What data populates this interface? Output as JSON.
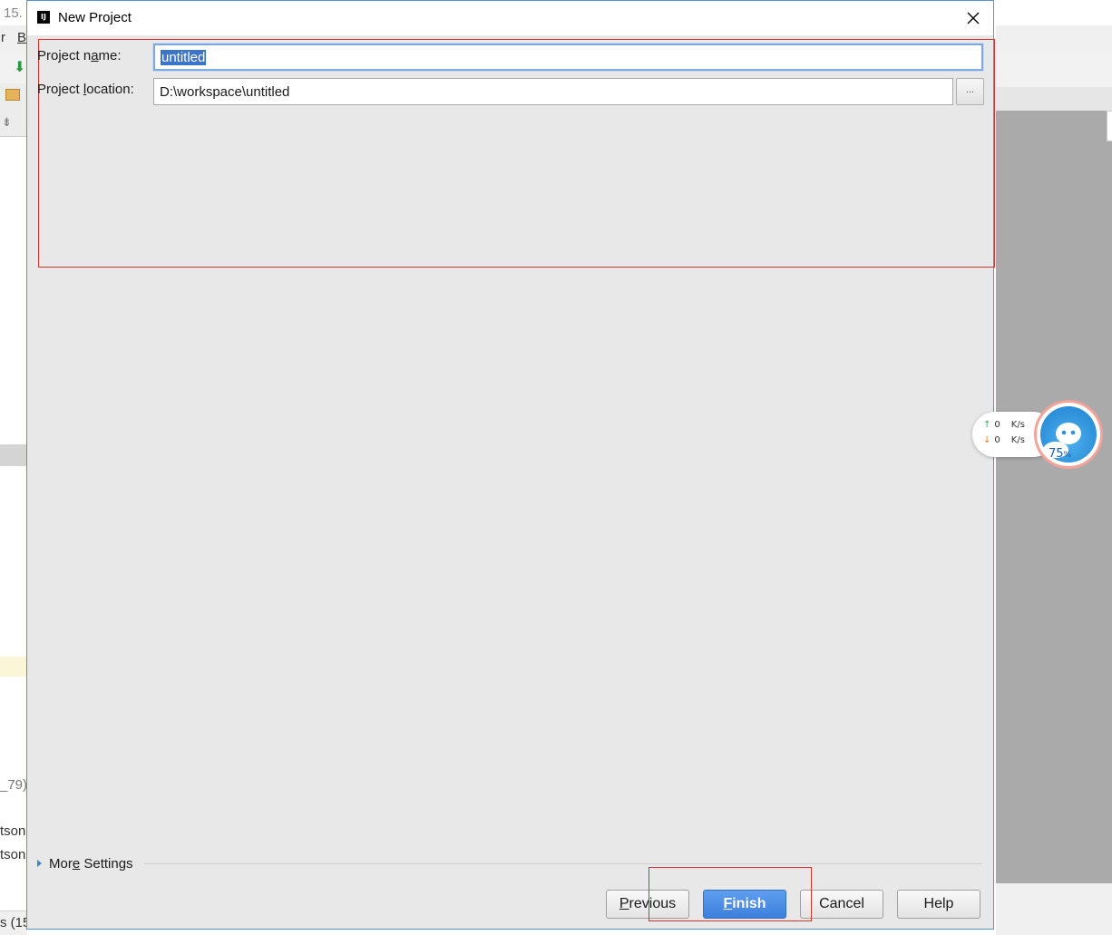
{
  "dialog": {
    "title": "New Project",
    "project_name_label": "Project name:",
    "project_name_value": "untitled",
    "project_location_label": "Project location:",
    "project_location_value": "D:\\workspace\\untitled",
    "browse_label": "...",
    "more_settings_label": "More Settings",
    "buttons": {
      "previous": "Previous",
      "finish": "Finish",
      "cancel": "Cancel",
      "help": "Help"
    }
  },
  "background": {
    "fragments": [
      "15.",
      "r",
      "B",
      "_79)",
      "tson",
      "tson",
      "s (15"
    ]
  },
  "net_widget": {
    "upload": "0",
    "download": "0",
    "unit": "K/s",
    "memory_percent": "75",
    "percent_sign": "%"
  },
  "colors": {
    "accent": "#3c7fdc",
    "highlight_box": "#d9342b",
    "dialog_bg": "#e8e8e8"
  }
}
